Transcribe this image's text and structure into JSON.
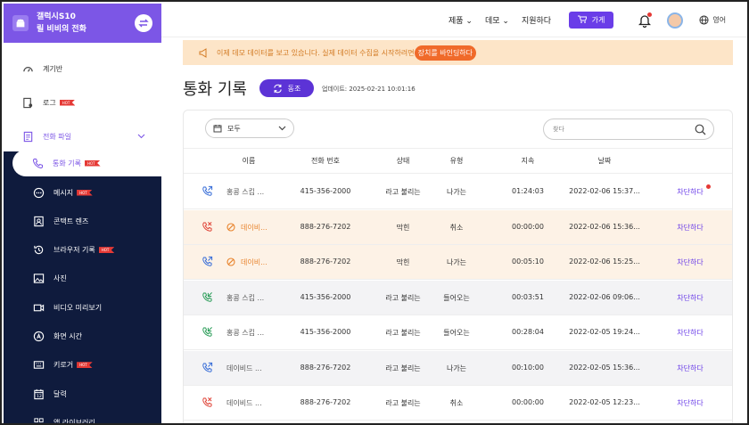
{
  "sidebar": {
    "device_name": "갤럭시S10",
    "device_owner": "릴 비비의 전화",
    "items": [
      {
        "label": "계기반",
        "icon": "dashboard-icon",
        "hot": false
      },
      {
        "label": "로그",
        "icon": "log-icon",
        "hot": true
      },
      {
        "label": "전화 파일",
        "icon": "phone-file-icon",
        "hot": false
      }
    ],
    "active_sub": {
      "label": "통화 기록",
      "icon": "phone-icon",
      "hot": true
    },
    "sub_items": [
      {
        "label": "메시지",
        "icon": "message-icon",
        "hot": true
      },
      {
        "label": "콘택트 렌즈",
        "icon": "contacts-icon",
        "hot": false
      },
      {
        "label": "브라우저 기록",
        "icon": "history-icon",
        "hot": true
      },
      {
        "label": "사진",
        "icon": "photo-icon",
        "hot": false
      },
      {
        "label": "비디오 미리보기",
        "icon": "video-icon",
        "hot": false
      },
      {
        "label": "화면 시간",
        "icon": "screen-time-icon",
        "hot": false
      },
      {
        "label": "키로거",
        "icon": "keyboard-icon",
        "hot": true
      },
      {
        "label": "달력",
        "icon": "calendar-icon",
        "hot": false
      },
      {
        "label": "앱 라이브러리",
        "icon": "app-library-icon",
        "hot": false
      }
    ],
    "hot_label": "HOT"
  },
  "topbar": {
    "product": "제품",
    "demo": "데모",
    "support": "지원하다",
    "buy": "가게",
    "language": "영어"
  },
  "banner": {
    "text": "이제 데모 데이터를 보고 있습니다. 실제 데이터 수집을 시작하려면",
    "link": "장치를 바인딩하다"
  },
  "page": {
    "title": "통화 기록",
    "sync_label": "동조",
    "updated": "업데이트: 2025-02-21 10:01:16"
  },
  "filter": {
    "value": "모두"
  },
  "search": {
    "placeholder": "찾다"
  },
  "table": {
    "headers": [
      "이름",
      "전화 번호",
      "상태",
      "유형",
      "지속",
      "날짜"
    ],
    "rows": [
      {
        "name": "홍콩 스킵 ...",
        "phone": "415-356-2000",
        "status": "라고 불리는",
        "type": "나가는",
        "duration": "01:24:03",
        "date": "2022-02-06 15:37...",
        "action": "차단하다",
        "icon": "outgoing-call-icon",
        "blocked": false,
        "dot": true
      },
      {
        "name": "데이비...",
        "phone": "888-276-7202",
        "status": "막힌",
        "type": "취소",
        "duration": "00:00:00",
        "date": "2022-02-06 15:36...",
        "action": "차단하다",
        "icon": "missed-call-icon",
        "blocked": true,
        "dot": false
      },
      {
        "name": "데이비...",
        "phone": "888-276-7202",
        "status": "막힌",
        "type": "나가는",
        "duration": "00:05:10",
        "date": "2022-02-06 15:25...",
        "action": "차단하다",
        "icon": "outgoing-call-icon",
        "blocked": true,
        "dot": false
      },
      {
        "name": "홍콩 스킵 ...",
        "phone": "415-356-2000",
        "status": "라고 불리는",
        "type": "들어오는",
        "duration": "00:03:51",
        "date": "2022-02-06 09:06...",
        "action": "차단하다",
        "icon": "incoming-call-icon",
        "blocked": false,
        "dot": false
      },
      {
        "name": "홍콩 스킵 ...",
        "phone": "415-356-2000",
        "status": "라고 불리는",
        "type": "들어오는",
        "duration": "00:28:04",
        "date": "2022-02-05 19:24...",
        "action": "차단하다",
        "icon": "incoming-call-icon",
        "blocked": false,
        "dot": false
      },
      {
        "name": "데이비드 ...",
        "phone": "888-276-7202",
        "status": "라고 불리는",
        "type": "나가는",
        "duration": "00:10:00",
        "date": "2022-02-05 15:36...",
        "action": "차단하다",
        "icon": "outgoing-call-icon",
        "blocked": false,
        "dot": false
      },
      {
        "name": "데이비드 ...",
        "phone": "888-276-7202",
        "status": "라고 불리는",
        "type": "취소",
        "duration": "00:00:00",
        "date": "2022-02-05 12:23...",
        "action": "차단하다",
        "icon": "missed-call-icon",
        "blocked": false,
        "dot": false
      }
    ]
  },
  "colors": {
    "accent": "#6a3de8",
    "sidebar": "#0f1b3d",
    "banner": "#fde5c8",
    "blocked_row": "#fdf2e6"
  }
}
